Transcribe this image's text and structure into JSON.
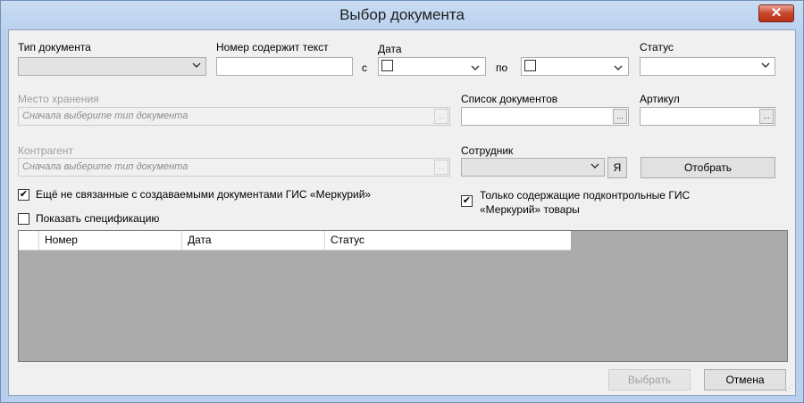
{
  "window": {
    "title": "Выбор документа",
    "close_label": "✕"
  },
  "fields": {
    "doc_type_label": "Тип документа",
    "number_label": "Номер содержит текст",
    "number_value": "",
    "date_label": "Дата",
    "date_from_prefix": "с",
    "date_to_prefix": "по",
    "status_label": "Статус",
    "storage_label": "Место хранения",
    "storage_placeholder": "Сначала выберите тип документа",
    "doc_list_label": "Список документов",
    "article_label": "Артикул",
    "counterparty_label": "Контрагент",
    "counterparty_placeholder": "Сначала выберите тип документа",
    "employee_label": "Сотрудник",
    "me_button": "Я",
    "filter_button": "Отобрать",
    "ellipsis": "..."
  },
  "checkboxes": {
    "not_linked": {
      "label": "Ещё не связанные с создаваемыми документами ГИС «Меркурий»",
      "checked": true
    },
    "only_controlled_line1": "Только содержащие подконтрольные ГИС",
    "only_controlled_line2": "«Меркурий» товары",
    "only_controlled_checked": true,
    "show_spec": {
      "label": "Показать спецификацию",
      "checked": false
    }
  },
  "grid": {
    "columns": [
      "Номер",
      "Дата",
      "Статус"
    ]
  },
  "footer": {
    "select_button": "Выбрать",
    "cancel_button": "Отмена"
  },
  "icons": {
    "check": "✔",
    "chevron": "⌵"
  }
}
